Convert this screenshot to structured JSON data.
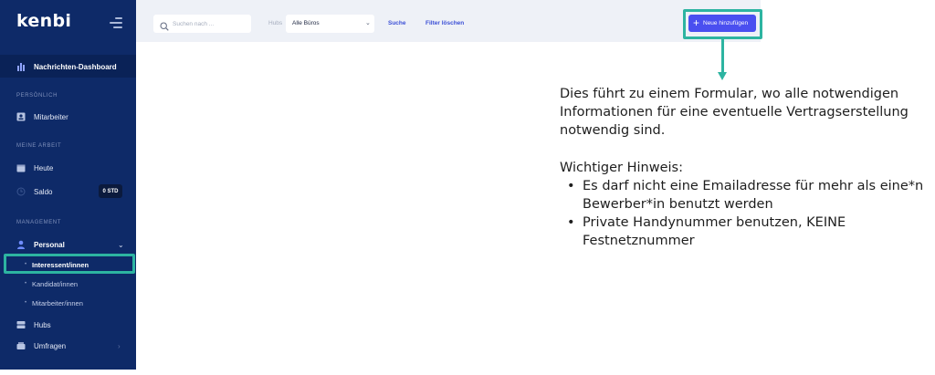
{
  "sidebar": {
    "logo": "kenbi",
    "active_item": "Nachrichten-Dashboard",
    "section_personal": "PERSÖNLICH",
    "item_mitarbeiter": "Mitarbeiter",
    "section_work": "MEINE ARBEIT",
    "item_heute": "Heute",
    "item_saldo": "Saldo",
    "saldo_badge": "0 STD",
    "section_management": "MANAGEMENT",
    "item_personal": "Personal",
    "sub_items": [
      "Interessent/innen",
      "Kandidat/innen",
      "Mitarbeiter/innen"
    ],
    "item_hubs": "Hubs",
    "item_umfragen": "Umfragen"
  },
  "toolbar": {
    "search_placeholder": "Suchen nach ...",
    "hubs_label": "Hubs",
    "hubs_value": "Alle Büros",
    "search_button": "Suche",
    "clear_filter_button": "Filter löschen",
    "new_button": "Neue hinzufügen"
  },
  "annotation": {
    "line1": "Dies führt zu einem Formular, wo alle notwendigen",
    "line2": "Informationen für eine eventuelle Vertragserstellung",
    "line3": "notwendig sind.",
    "hint_title": "Wichtiger Hinweis:",
    "bullet1_line1": "Es darf nicht eine Emailadresse für mehr als eine*n",
    "bullet1_line2": "Bewerber*in benutzt werden",
    "bullet2_line1": "Private Handynummer benutzen, KEINE",
    "bullet2_line2": "Festnetznummer"
  },
  "colors": {
    "sidebar_bg": "#0e2a68",
    "accent_teal": "#2db4a1",
    "button_blue": "#4a4ff0",
    "link_blue": "#3b4fd6"
  }
}
